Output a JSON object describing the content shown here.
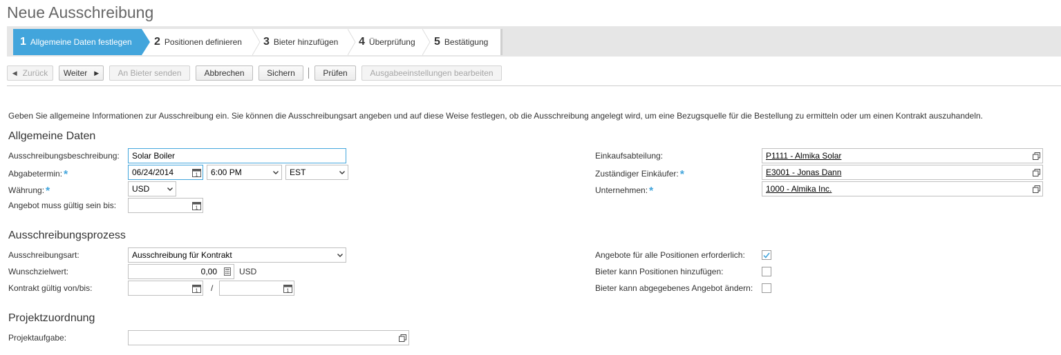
{
  "page": {
    "title": "Neue Ausschreibung"
  },
  "wizard": {
    "steps": [
      {
        "num": "1",
        "label": "Allgemeine Daten festlegen"
      },
      {
        "num": "2",
        "label": "Positionen definieren"
      },
      {
        "num": "3",
        "label": "Bieter hinzufügen"
      },
      {
        "num": "4",
        "label": "Überprüfung"
      },
      {
        "num": "5",
        "label": "Bestätigung"
      }
    ]
  },
  "toolbar": {
    "back": "Zurück",
    "next": "Weiter",
    "send": "An Bieter senden",
    "cancel": "Abbrechen",
    "save": "Sichern",
    "check": "Prüfen",
    "output": "Ausgabeeinstellungen bearbeiten"
  },
  "intro": "Geben Sie allgemeine Informationen zur Ausschreibung ein. Sie können die Ausschreibungsart angeben und auf diese Weise festlegen, ob die Ausschreibung angelegt wird, um eine Bezugsquelle für die Bestellung zu ermitteln oder um einen Kontrakt auszuhandeln.",
  "general": {
    "title": "Allgemeine Daten",
    "description_label": "Ausschreibungsbeschreibung:",
    "description_value": "Solar Boiler",
    "deadline_label": "Abgabetermin:",
    "deadline_date": "06/24/2014",
    "deadline_time": "6:00 PM",
    "deadline_tz": "EST",
    "currency_label": "Währung:",
    "currency_value": "USD",
    "valid_until_label": "Angebot muss gültig sein bis:",
    "valid_until_value": "",
    "purch_dept_label": "Einkaufsabteilung:",
    "purch_dept_value": "P1111 - Almika Solar",
    "buyer_label": "Zuständiger Einkäufer:",
    "buyer_value": "E3001 - Jonas Dann",
    "company_label": "Unternehmen:",
    "company_value": "1000 - Almika Inc."
  },
  "process": {
    "title": "Ausschreibungsprozess",
    "type_label": "Ausschreibungsart:",
    "type_value": "Ausschreibung für Kontrakt",
    "target_label": "Wunschzielwert:",
    "target_value": "0,00",
    "target_currency": "USD",
    "contract_label": "Kontrakt gültig von/bis:",
    "contract_sep": "/",
    "bids_all_label": "Angebote für alle Positionen erforderlich:",
    "bids_all_checked": true,
    "add_items_label": "Bieter kann Positionen hinzufügen:",
    "add_items_checked": false,
    "change_bid_label": "Bieter kann abgegebenes Angebot ändern:",
    "change_bid_checked": false
  },
  "project": {
    "title": "Projektzuordnung",
    "task_label": "Projektaufgabe:",
    "task_value": ""
  }
}
